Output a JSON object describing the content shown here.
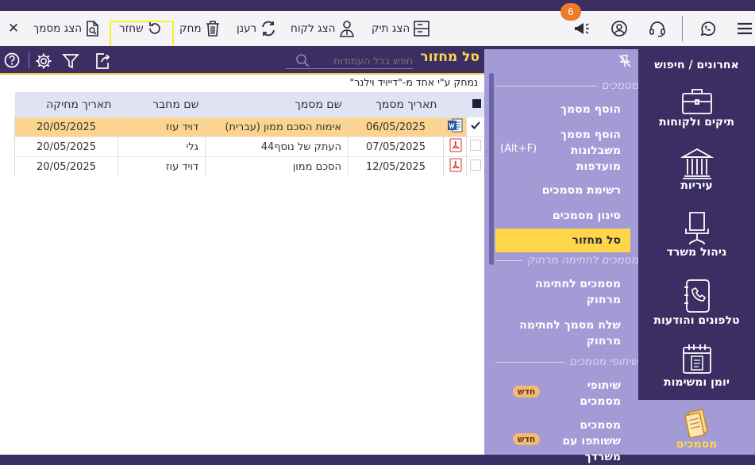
{
  "toolbar": {
    "close_label": "✕",
    "show_document": "הצג מסמך",
    "restore": "שחזר",
    "delete": "מחק",
    "refresh": "רענן",
    "show_client": "הצג לקוח",
    "show_file": "הצג תיק",
    "notification_count": "6"
  },
  "content": {
    "title": "סל מחזור",
    "search_placeholder": "חפש בכל העמודות",
    "deleted_by": "נמחק ע\"י אחד מ-\"דייויד וילנר\""
  },
  "table": {
    "headers": {
      "date": "תאריך מסמך",
      "name": "שם מסמך",
      "author": "שם מחבר",
      "deleted": "תאריך מחיקה"
    },
    "rows": [
      {
        "checked": true,
        "type": "word",
        "date": "06/05/2025",
        "name": "אימות הסכם ממון (עברית)",
        "author": "דויד עוז",
        "deleted": "20/05/2025"
      },
      {
        "checked": false,
        "type": "pdf",
        "date": "07/05/2025",
        "name": "העתק של  נוסף44",
        "author": "גלי",
        "deleted": "20/05/2025"
      },
      {
        "checked": false,
        "type": "pdf",
        "date": "12/05/2025",
        "name": "הסכם ממון",
        "author": "דויד עוז",
        "deleted": "20/05/2025"
      }
    ]
  },
  "menu": {
    "section_documents": "מסמכים",
    "add_document": "הוסף מסמך",
    "add_from_template_1": "הוסף מסמך",
    "add_from_template_2": "משבלונות",
    "add_from_template_3": "מועדפות",
    "shortcut": "(Alt+F)",
    "document_list": "רשימת מסמכים",
    "filter_documents": "סינון מסמכים",
    "recycle_bin": "סל מחזור",
    "section_remote_sign": "מסמכים לחתימה מרחוק",
    "remote_sign_docs_1": "מסמכים לחתימה",
    "remote_sign_docs_2": "מרחוק",
    "send_remote_sign_1": "שלח מסמך לחתימה",
    "send_remote_sign_2": "מרחוק",
    "section_sharing": "שיתופי מסמכים",
    "doc_shares_1": "שיתופי",
    "doc_shares_2": "מסמכים",
    "shared_with_1": "מסמכים",
    "shared_with_2": "ששותפו עם",
    "shared_with_3": "משרדך",
    "new_badge": "חדש"
  },
  "nav": {
    "recent_search": "אחרונים / חיפוש",
    "files_clients": "תיקים ולקוחות",
    "cities": "עיריות",
    "office_management": "ניהול משרד",
    "phones_messages": "טלפונים והודעות",
    "calendar_tasks": "יומן ומשימות",
    "documents": "מסמכים"
  }
}
